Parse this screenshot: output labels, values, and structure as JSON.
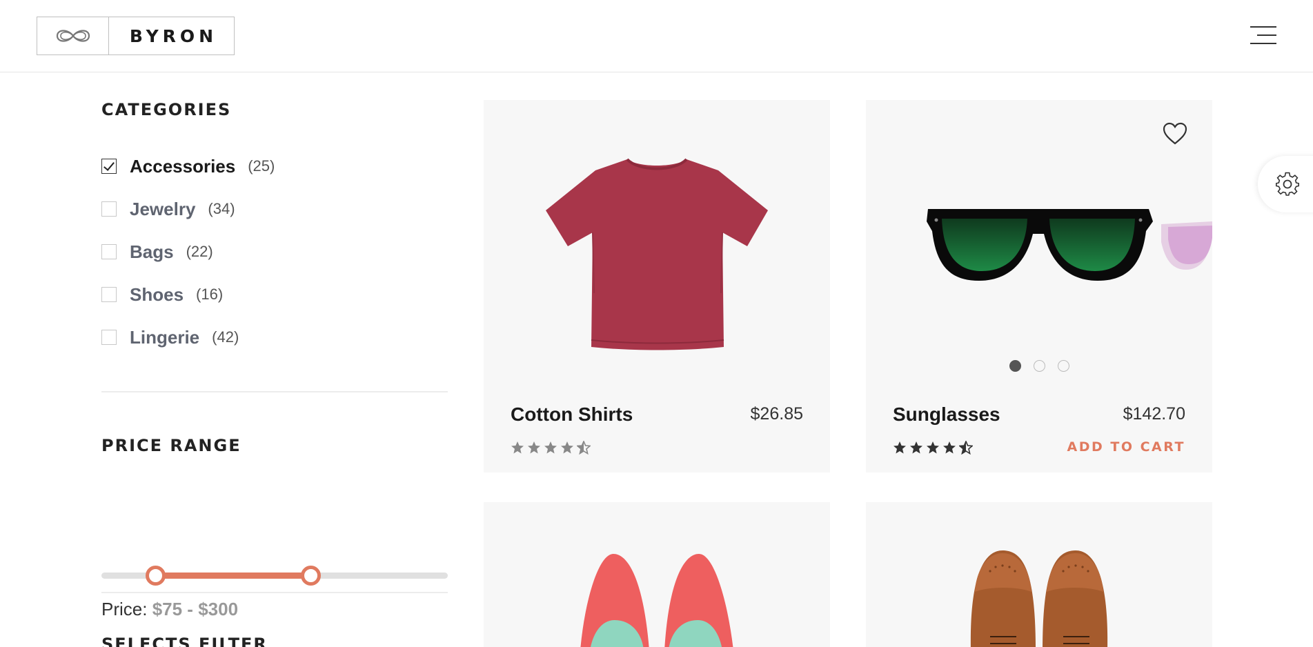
{
  "header": {
    "brand": "BYRON",
    "logo_icon": "infinity-icon",
    "menu_icon": "hamburger-menu-icon"
  },
  "sidebar": {
    "categories_title": "CATEGORIES",
    "categories": [
      {
        "name": "Accessories",
        "count": "(25)",
        "checked": true
      },
      {
        "name": "Jewelry",
        "count": "(34)",
        "checked": false
      },
      {
        "name": "Bags",
        "count": "(22)",
        "checked": false
      },
      {
        "name": "Shoes",
        "count": "(16)",
        "checked": false
      },
      {
        "name": "Lingerie",
        "count": "(42)",
        "checked": false
      }
    ],
    "price_title": "PRICE RANGE",
    "price_label": "Price:",
    "price_value": "$75 - $300",
    "price_range_min_fraction": 0.16,
    "price_range_max_fraction": 0.6,
    "filter_title": "SELECTS FILTER"
  },
  "products": [
    {
      "name": "Cotton Shirts",
      "price": "$26.85",
      "rating": 4.5
    },
    {
      "name": "Sunglasses",
      "price": "$142.70",
      "rating": 4.5,
      "add_to_cart": "ADD TO CART",
      "carousel_dots": 3,
      "active_dot": 0
    },
    {
      "name": "Red Pumps",
      "price": "",
      "rating": 0
    },
    {
      "name": "Brown Brogues",
      "price": "",
      "rating": 0
    }
  ],
  "colors": {
    "accent": "#e07a5f",
    "card_bg": "#f7f7f7",
    "text_dark": "#1a1a1a"
  },
  "icons": {
    "wishlist": "heart-icon",
    "settings": "gear-icon",
    "star": "star-icon"
  }
}
